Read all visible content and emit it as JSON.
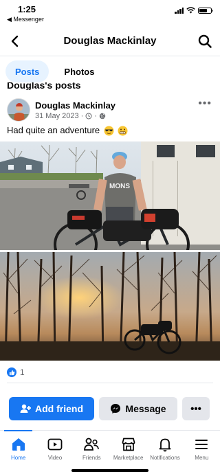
{
  "status_bar": {
    "time": "1:25",
    "back_label": "◀ Messenger"
  },
  "header": {
    "title": "Douglas Mackinlay"
  },
  "tabs": [
    {
      "label": "Posts",
      "active": true
    },
    {
      "label": "Photos",
      "active": false
    }
  ],
  "section_heading": "Douglas's posts",
  "post": {
    "author": "Douglas Mackinlay",
    "date": "31 May 2023",
    "separator": "·",
    "text": "Had quite an adventure",
    "reaction_count": "1"
  },
  "actions": {
    "add_friend": "Add friend",
    "message": "Message"
  },
  "bottom_nav": [
    {
      "label": "Home",
      "icon": "home-icon",
      "active": true
    },
    {
      "label": "Video",
      "icon": "video-icon",
      "active": false
    },
    {
      "label": "Friends",
      "icon": "friends-icon",
      "active": false
    },
    {
      "label": "Marketplace",
      "icon": "marketplace-icon",
      "active": false
    },
    {
      "label": "Notifications",
      "icon": "bell-icon",
      "active": false
    },
    {
      "label": "Menu",
      "icon": "menu-icon",
      "active": false
    }
  ],
  "colors": {
    "accent": "#1877f2",
    "secondary_button": "#e4e6eb",
    "muted_text": "#65676b"
  }
}
